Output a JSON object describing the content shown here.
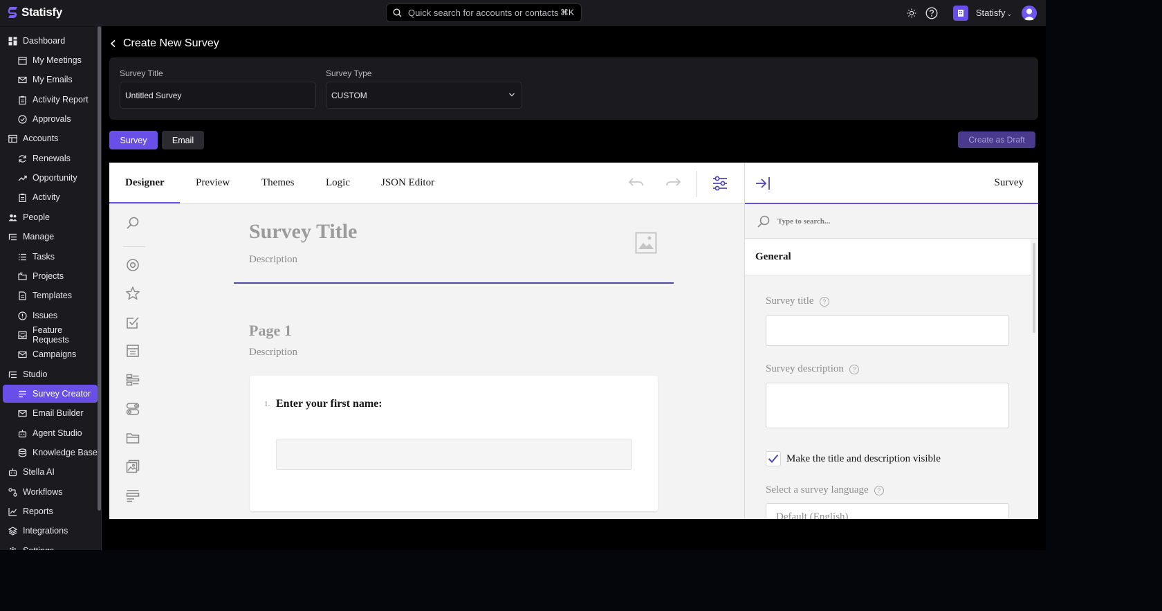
{
  "app": {
    "name": "Statisfy"
  },
  "topbar": {
    "search_placeholder": "Quick search for accounts or contacts",
    "search_shortcut": "⌘K",
    "org_name": "Statisfy"
  },
  "sidebar": {
    "items": [
      {
        "label": "Dashboard",
        "level": "top",
        "icon": "dashboard-icon"
      },
      {
        "label": "My Meetings",
        "level": "sub",
        "icon": "calendar-icon"
      },
      {
        "label": "My Emails",
        "level": "sub",
        "icon": "mail-icon"
      },
      {
        "label": "Activity Report",
        "level": "sub",
        "icon": "clipboard-icon"
      },
      {
        "label": "Approvals",
        "level": "sub",
        "icon": "check-circle-icon"
      },
      {
        "label": "Accounts",
        "level": "top",
        "icon": "accounts-icon"
      },
      {
        "label": "Renewals",
        "level": "sub",
        "icon": "refresh-icon"
      },
      {
        "label": "Opportunity",
        "level": "sub",
        "icon": "trend-icon"
      },
      {
        "label": "Activity",
        "level": "sub",
        "icon": "clipboard-icon"
      },
      {
        "label": "People",
        "level": "top",
        "icon": "people-icon"
      },
      {
        "label": "Manage",
        "level": "top",
        "icon": "manage-icon"
      },
      {
        "label": "Tasks",
        "level": "sub",
        "icon": "list-icon"
      },
      {
        "label": "Projects",
        "level": "sub",
        "icon": "folders-icon"
      },
      {
        "label": "Templates",
        "level": "sub",
        "icon": "document-icon"
      },
      {
        "label": "Issues",
        "level": "sub",
        "icon": "alert-circle-icon"
      },
      {
        "label": "Feature Requests",
        "level": "sub",
        "icon": "inbox-icon"
      },
      {
        "label": "Campaigns",
        "level": "sub",
        "icon": "mail-icon"
      },
      {
        "label": "Studio",
        "level": "top",
        "icon": "studio-icon"
      },
      {
        "label": "Survey Creator",
        "level": "sub",
        "icon": "survey-icon",
        "active": true
      },
      {
        "label": "Email Builder",
        "level": "sub",
        "icon": "mail-icon"
      },
      {
        "label": "Agent Studio",
        "level": "sub",
        "icon": "bot-icon"
      },
      {
        "label": "Knowledge Base",
        "level": "sub",
        "icon": "database-icon"
      },
      {
        "label": "Stella AI",
        "level": "top",
        "icon": "bot-icon"
      },
      {
        "label": "Workflows",
        "level": "top",
        "icon": "workflow-icon"
      },
      {
        "label": "Reports",
        "level": "top",
        "icon": "chart-icon"
      },
      {
        "label": "Integrations",
        "level": "top",
        "icon": "layers-icon"
      },
      {
        "label": "Settings",
        "level": "top",
        "icon": "gear-icon"
      }
    ]
  },
  "page": {
    "title": "Create New Survey",
    "survey_title_label": "Survey Title",
    "survey_title_value": "Untitled Survey",
    "survey_type_label": "Survey Type",
    "survey_type_value": "CUSTOM",
    "survey_button": "Survey",
    "email_button": "Email",
    "create_draft_button": "Create as Draft"
  },
  "designer": {
    "tabs": [
      "Designer",
      "Preview",
      "Themes",
      "Logic",
      "JSON Editor"
    ],
    "active_tab": "Designer",
    "survey_title_placeholder": "Survey Title",
    "survey_description_placeholder": "Description",
    "page_name": "Page 1",
    "page_description_placeholder": "Description",
    "question_number": "1.",
    "question_text": "Enter your first name:"
  },
  "property_panel": {
    "header": "Survey",
    "search_placeholder": "Type to search...",
    "category": "General",
    "survey_title_label": "Survey title",
    "survey_description_label": "Survey description",
    "visible_checkbox_label": "Make the title and description visible",
    "visible_checked": true,
    "language_label": "Select a survey language",
    "language_value": "Default (English)"
  },
  "colors": {
    "accent": "#6a4ee8",
    "topbar_bg": "#1a1a1f",
    "designer_bg": "#f3f3f3"
  }
}
